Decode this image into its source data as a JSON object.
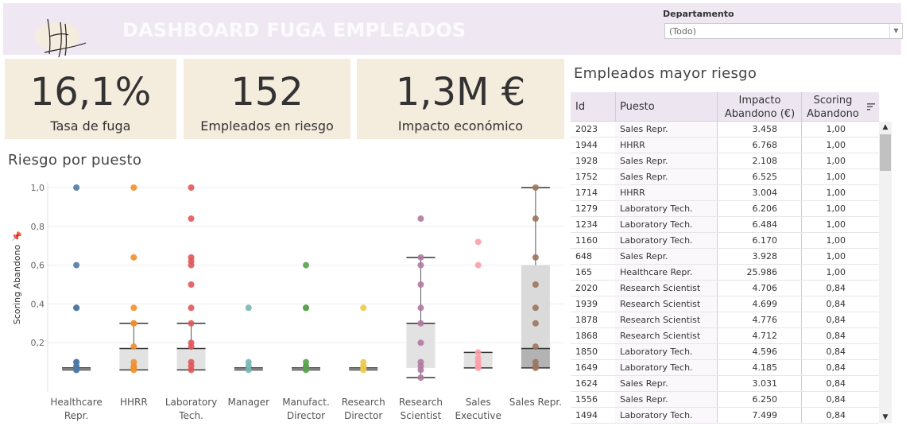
{
  "header": {
    "title": "DASHBOARD FUGA EMPLEADOS",
    "logo_text": "LH",
    "department_label": "Departamento",
    "department_value": "(Todo)"
  },
  "kpis": [
    {
      "value": "16,1%",
      "label": "Tasa de fuga"
    },
    {
      "value": "152",
      "label": "Empleados en riesgo"
    },
    {
      "value": "1,3M €",
      "label": "Impacto económico"
    }
  ],
  "chart_title": "Riesgo por puesto",
  "chart_data": {
    "type": "scatter",
    "subtype": "box-plot with jittered points",
    "ylabel": "Scoring Abandono",
    "ylim": [
      0,
      1.0
    ],
    "yticks": [
      "0,2",
      "0,4",
      "0,6",
      "0,8",
      "1,0"
    ],
    "grid": true,
    "categories": [
      "Healthcare Repr.",
      "HHRR",
      "Laboratory Tech.",
      "Manager",
      "Manufact. Director",
      "Research Director",
      "Research Scientist",
      "Sales Executive",
      "Sales Repr."
    ],
    "category_lines": [
      [
        "Healthcare",
        "Repr."
      ],
      [
        "HHRR"
      ],
      [
        "Laboratory",
        "Tech."
      ],
      [
        "Manager"
      ],
      [
        "Manufact.",
        "Director"
      ],
      [
        "Research",
        "Director"
      ],
      [
        "Research",
        "Scientist"
      ],
      [
        "Sales",
        "Executive"
      ],
      [
        "Sales Repr."
      ]
    ],
    "colors": [
      "#4e79a7",
      "#f28e2b",
      "#e15759",
      "#76b7b2",
      "#59a14f",
      "#edc948",
      "#b07aa1",
      "#ff9da7",
      "#9c755f"
    ],
    "series": [
      {
        "values": [
          1.0,
          0.6,
          0.38,
          0.38,
          0.1,
          0.1,
          0.08,
          0.07,
          0.06,
          0.06
        ],
        "box": [
          0.06,
          0.065,
          0.07,
          0.07
        ]
      },
      {
        "values": [
          1.0,
          0.64,
          0.38,
          0.3,
          0.3,
          0.18,
          0.1,
          0.08,
          0.07,
          0.06
        ],
        "box": [
          0.06,
          0.065,
          0.17,
          0.3
        ]
      },
      {
        "values": [
          1.0,
          0.84,
          0.64,
          0.62,
          0.6,
          0.5,
          0.38,
          0.3,
          0.2,
          0.18,
          0.1,
          0.08,
          0.06
        ],
        "box": [
          0.06,
          0.065,
          0.17,
          0.3
        ]
      },
      {
        "values": [
          0.38,
          0.1,
          0.08,
          0.06
        ],
        "box": [
          0.06,
          0.065,
          0.07,
          0.07
        ]
      },
      {
        "values": [
          0.6,
          0.38,
          0.38,
          0.1,
          0.08,
          0.07,
          0.06
        ],
        "box": [
          0.06,
          0.065,
          0.07,
          0.07
        ]
      },
      {
        "values": [
          0.38,
          0.1,
          0.08,
          0.07,
          0.06
        ],
        "box": [
          0.06,
          0.065,
          0.07,
          0.07
        ]
      },
      {
        "values": [
          0.84,
          0.64,
          0.6,
          0.5,
          0.38,
          0.3,
          0.2,
          0.1,
          0.08,
          0.06,
          0.02
        ],
        "box": [
          0.02,
          0.07,
          0.3,
          0.64
        ]
      },
      {
        "values": [
          0.72,
          0.6,
          0.15,
          0.12,
          0.1,
          0.08,
          0.07
        ],
        "box": [
          0.07,
          0.07,
          0.15,
          0.15
        ]
      },
      {
        "values": [
          1.0,
          0.84,
          0.64,
          0.5,
          0.38,
          0.3,
          0.18,
          0.1,
          0.08,
          0.07
        ],
        "box": [
          0.07,
          0.1,
          0.17,
          0.6,
          1.0
        ]
      }
    ]
  },
  "table": {
    "title": "Empleados mayor riesgo",
    "columns": {
      "id": "Id",
      "puesto": "Puesto",
      "impacto": "Impacto Abandono (€)",
      "impacto_l1": "Impacto",
      "impacto_l2": "Abandono (€)",
      "scoring_l1": "Scoring",
      "scoring_l2": "Abandono"
    },
    "rows": [
      [
        "2023",
        "Sales Repr.",
        "3.458",
        "1,00"
      ],
      [
        "1944",
        "HHRR",
        "6.768",
        "1,00"
      ],
      [
        "1928",
        "Sales Repr.",
        "2.108",
        "1,00"
      ],
      [
        "1752",
        "Sales Repr.",
        "6.525",
        "1,00"
      ],
      [
        "1714",
        "HHRR",
        "3.004",
        "1,00"
      ],
      [
        "1279",
        "Laboratory Tech.",
        "6.206",
        "1,00"
      ],
      [
        "1234",
        "Laboratory Tech.",
        "6.484",
        "1,00"
      ],
      [
        "1160",
        "Laboratory Tech.",
        "6.170",
        "1,00"
      ],
      [
        "648",
        "Sales Repr.",
        "3.928",
        "1,00"
      ],
      [
        "165",
        "Healthcare Repr.",
        "25.986",
        "1,00"
      ],
      [
        "2020",
        "Research Scientist",
        "4.706",
        "0,84"
      ],
      [
        "1939",
        "Research Scientist",
        "4.699",
        "0,84"
      ],
      [
        "1878",
        "Research Scientist",
        "4.776",
        "0,84"
      ],
      [
        "1868",
        "Research Scientist",
        "4.712",
        "0,84"
      ],
      [
        "1850",
        "Laboratory Tech.",
        "4.596",
        "0,84"
      ],
      [
        "1649",
        "Laboratory Tech.",
        "4.185",
        "0,84"
      ],
      [
        "1624",
        "Sales Repr.",
        "3.031",
        "0,84"
      ],
      [
        "1556",
        "Sales Repr.",
        "6.250",
        "0,84"
      ],
      [
        "1494",
        "Laboratory Tech.",
        "7.499",
        "0,84"
      ]
    ]
  }
}
